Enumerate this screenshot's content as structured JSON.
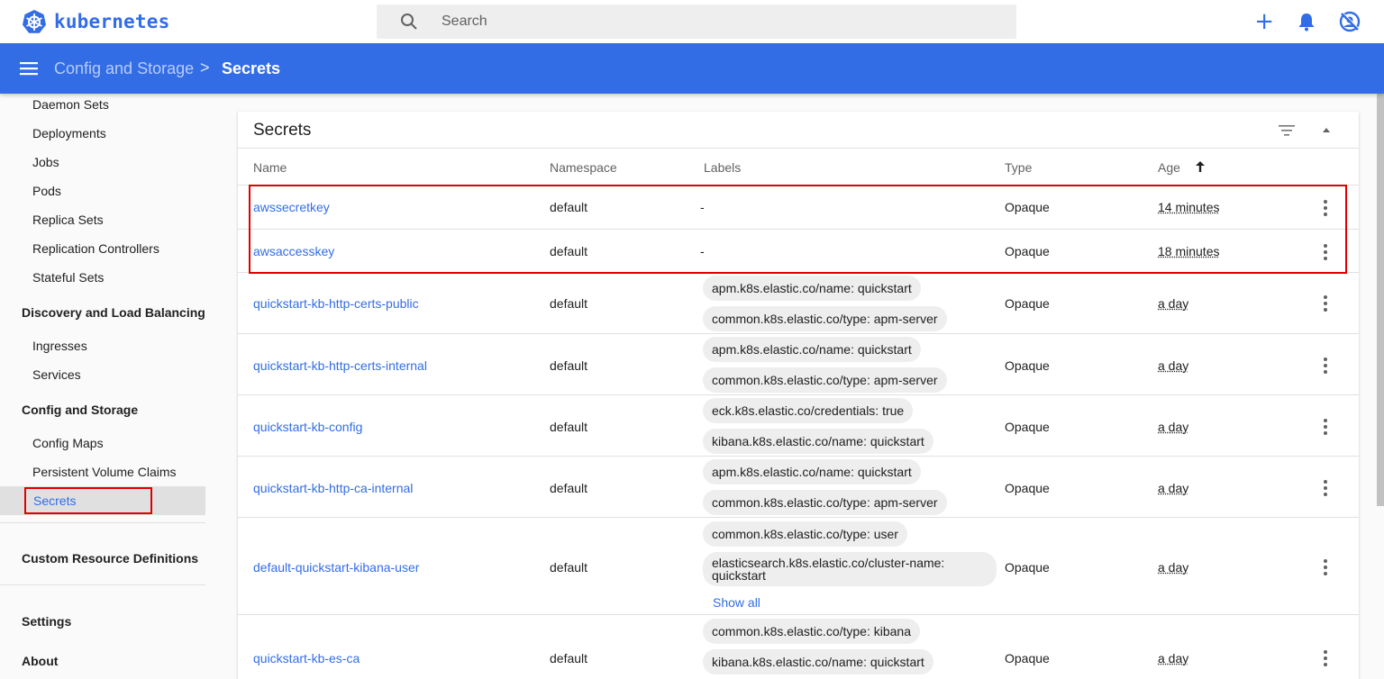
{
  "app": {
    "logo_text": "kubernetes",
    "brand_color": "#326de6"
  },
  "search": {
    "placeholder": "Search"
  },
  "breadcrumb": {
    "parent": "Config and Storage",
    "separator": ">",
    "current": "Secrets"
  },
  "sidebar": {
    "workloads_items": [
      "Daemon Sets",
      "Deployments",
      "Jobs",
      "Pods",
      "Replica Sets",
      "Replication Controllers",
      "Stateful Sets"
    ],
    "discovery_section": "Discovery and Load Balancing",
    "discovery_items": [
      "Ingresses",
      "Services"
    ],
    "config_section": "Config and Storage",
    "config_items": [
      "Config Maps",
      "Persistent Volume Claims",
      "Secrets"
    ],
    "crd_section": "Custom Resource Definitions",
    "settings": "Settings",
    "about": "About"
  },
  "card": {
    "title": "Secrets",
    "columns": {
      "name": "Name",
      "namespace": "Namespace",
      "labels": "Labels",
      "type": "Type",
      "age": "Age"
    }
  },
  "rows": [
    {
      "name": "awssecretkey",
      "namespace": "default",
      "labels": [
        "-"
      ],
      "type": "Opaque",
      "age": "14 minutes"
    },
    {
      "name": "awsaccesskey",
      "namespace": "default",
      "labels": [
        "-"
      ],
      "type": "Opaque",
      "age": "18 minutes"
    },
    {
      "name": "quickstart-kb-http-certs-public",
      "namespace": "default",
      "labels": [
        "apm.k8s.elastic.co/name: quickstart",
        "common.k8s.elastic.co/type: apm-server"
      ],
      "type": "Opaque",
      "age": "a day"
    },
    {
      "name": "quickstart-kb-http-certs-internal",
      "namespace": "default",
      "labels": [
        "apm.k8s.elastic.co/name: quickstart",
        "common.k8s.elastic.co/type: apm-server"
      ],
      "type": "Opaque",
      "age": "a day"
    },
    {
      "name": "quickstart-kb-config",
      "namespace": "default",
      "labels": [
        "eck.k8s.elastic.co/credentials: true",
        "kibana.k8s.elastic.co/name: quickstart"
      ],
      "type": "Opaque",
      "age": "a day"
    },
    {
      "name": "quickstart-kb-http-ca-internal",
      "namespace": "default",
      "labels": [
        "apm.k8s.elastic.co/name: quickstart",
        "common.k8s.elastic.co/type: apm-server"
      ],
      "type": "Opaque",
      "age": "a day"
    },
    {
      "name": "default-quickstart-kibana-user",
      "namespace": "default",
      "labels": [
        "common.k8s.elastic.co/type: user",
        "elasticsearch.k8s.elastic.co/cluster-name: quickstart"
      ],
      "show_all": "Show all",
      "type": "Opaque",
      "age": "a day"
    },
    {
      "name": "quickstart-kb-es-ca",
      "namespace": "default",
      "labels": [
        "common.k8s.elastic.co/type: kibana",
        "kibana.k8s.elastic.co/name: quickstart"
      ],
      "type": "Opaque",
      "age": "a day"
    }
  ]
}
